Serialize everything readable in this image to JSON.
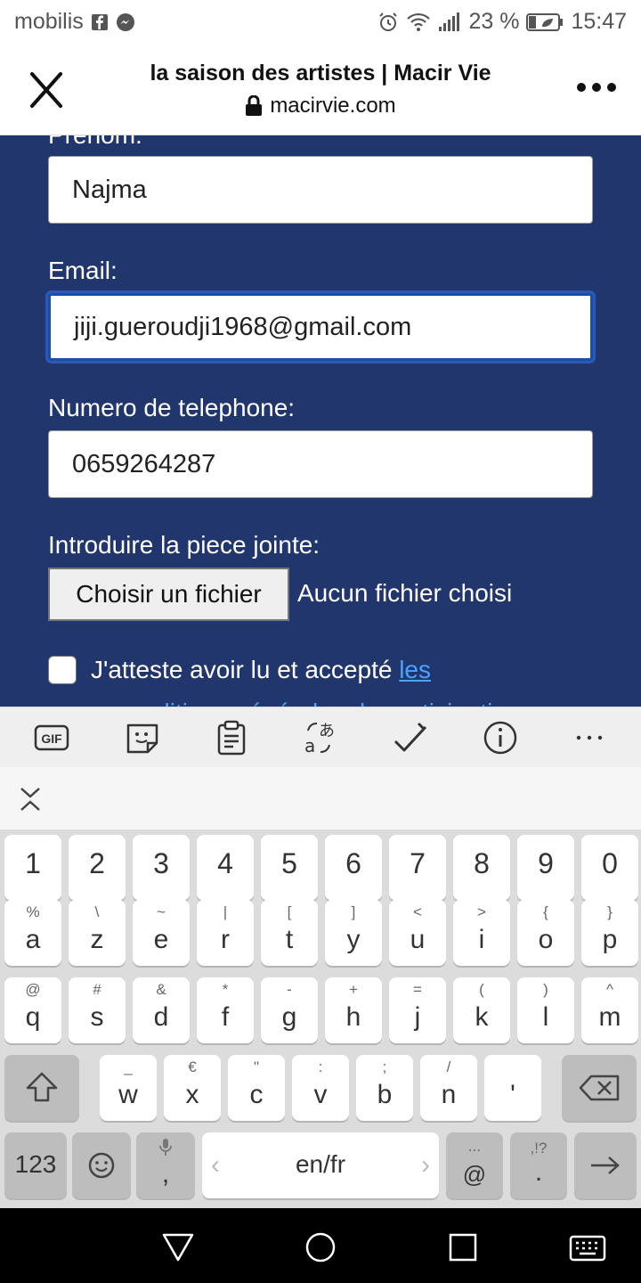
{
  "status_bar": {
    "carrier": "mobilis",
    "battery": "23 %",
    "time": "15:47"
  },
  "browser": {
    "title": "la saison des artistes | Macir Vie",
    "url": "macirvie.com"
  },
  "form": {
    "prenom_label": "Prénom:",
    "prenom_value": "Najma",
    "email_label": "Email:",
    "email_value": "jiji.gueroudji1968@gmail.com",
    "phone_label": "Numero de telephone:",
    "phone_value": "0659264287",
    "attachment_label": "Introduire la piece jointe:",
    "file_button": "Choisir un fichier",
    "file_status": "Aucun fichier choisi",
    "consent_text": "J'atteste avoir lu et accepté ",
    "consent_link": "les",
    "consent_cut": "conditions générales de participation"
  },
  "keyboard": {
    "number_row": [
      "1",
      "2",
      "3",
      "4",
      "5",
      "6",
      "7",
      "8",
      "9",
      "0"
    ],
    "row1": [
      {
        "main": "a",
        "sub": "%"
      },
      {
        "main": "z",
        "sub": "\\"
      },
      {
        "main": "e",
        "sub": "~"
      },
      {
        "main": "r",
        "sub": "|"
      },
      {
        "main": "t",
        "sub": "["
      },
      {
        "main": "y",
        "sub": "]"
      },
      {
        "main": "u",
        "sub": "<"
      },
      {
        "main": "i",
        "sub": ">"
      },
      {
        "main": "o",
        "sub": "{"
      },
      {
        "main": "p",
        "sub": "}"
      }
    ],
    "row2": [
      {
        "main": "q",
        "sub": "@"
      },
      {
        "main": "s",
        "sub": "#"
      },
      {
        "main": "d",
        "sub": "&"
      },
      {
        "main": "f",
        "sub": "*"
      },
      {
        "main": "g",
        "sub": "-"
      },
      {
        "main": "h",
        "sub": "+"
      },
      {
        "main": "j",
        "sub": "="
      },
      {
        "main": "k",
        "sub": "("
      },
      {
        "main": "l",
        "sub": ")"
      },
      {
        "main": "m",
        "sub": "^"
      }
    ],
    "row3": [
      {
        "main": "w",
        "sub": "_"
      },
      {
        "main": "x",
        "sub": "€"
      },
      {
        "main": "c",
        "sub": "\""
      },
      {
        "main": "v",
        "sub": ":"
      },
      {
        "main": "b",
        "sub": ";"
      },
      {
        "main": "n",
        "sub": "/"
      },
      {
        "main": "'",
        "sub": ""
      }
    ],
    "num_switch": "123",
    "comma": ",",
    "language": "en/fr",
    "at_key": "@",
    "at_sub": "...",
    "period": ".",
    "period_sub": ",!?"
  },
  "toolbar_icons": [
    "gif-icon",
    "sticker-icon",
    "clipboard-icon",
    "translate-icon",
    "handwriting-icon",
    "info-icon",
    "more-icon"
  ]
}
